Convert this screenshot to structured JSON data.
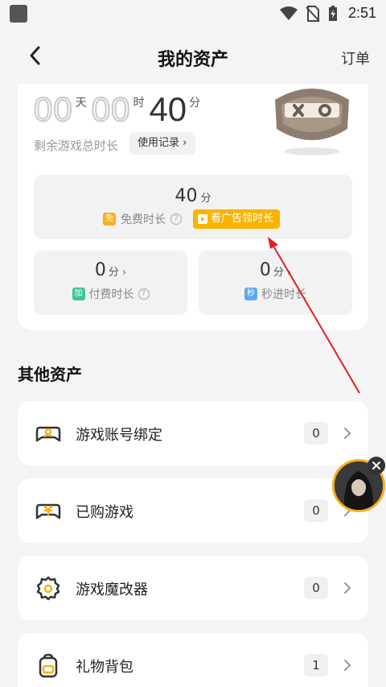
{
  "status_bar": {
    "time": "2:51",
    "icons": [
      "wifi-icon",
      "no-sim-icon",
      "battery-charging-icon"
    ]
  },
  "nav": {
    "title": "我的资产",
    "right_label": "订单",
    "back_icon": "chevron-left-icon"
  },
  "total_time": {
    "days": "00",
    "days_unit": "天",
    "hours": "00",
    "hours_unit": "时",
    "minutes": "40",
    "minutes_unit": "分",
    "label": "剩余游戏总时长",
    "record_button": "使用记录 ›"
  },
  "free_time": {
    "value": "40",
    "unit": "分",
    "tag": "免",
    "label": "免费时长",
    "ad_button": "看广告领时长"
  },
  "paid_time": {
    "value": "0",
    "unit": "分 ›",
    "tag": "加",
    "label": "付费时长"
  },
  "instant_time": {
    "value": "0",
    "unit": "分 ›",
    "tag": "秒",
    "label": "秒进时长"
  },
  "other_assets": {
    "title": "其他资产",
    "items": [
      {
        "label": "游戏账号绑定",
        "count": "0",
        "icon": "gamepad-user-icon"
      },
      {
        "label": "已购游戏",
        "count": "0",
        "icon": "gamepad-purchase-icon"
      },
      {
        "label": "游戏魔改器",
        "count": "0",
        "icon": "gear-icon"
      },
      {
        "label": "礼物背包",
        "count": "1",
        "icon": "backpack-icon"
      }
    ]
  },
  "colors": {
    "accent": "#f9b400",
    "arrow": "#e02020",
    "background": "#f4f4f6"
  }
}
